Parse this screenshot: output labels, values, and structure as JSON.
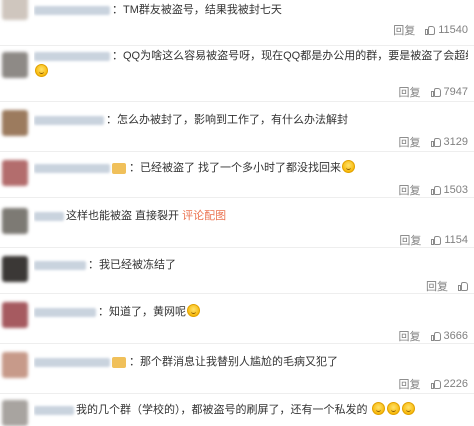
{
  "comments": [
    {
      "avatar_color": "#cfc6be",
      "text": "TM群友被盗号，结果我被封七天",
      "badge": false,
      "emoji_count": 0,
      "reply": "回复",
      "likes": "11540"
    },
    {
      "avatar_color": "#8e8a86",
      "text": "QQ为啥这么容易被盗号呀，现在QQ都是办公用的群，要是被盗了会超级无敌麻烦",
      "badge": false,
      "emoji_count": 1,
      "text_tail_emoji": 1,
      "reply": "回复",
      "likes": "7947"
    },
    {
      "avatar_color": "#9c7b5e",
      "text": "怎么办被封了，影响到工作了，有什么办法解封",
      "badge": false,
      "emoji_count": 0,
      "reply": "回复",
      "likes": "3129"
    },
    {
      "avatar_color": "#b36d6d",
      "text": "已经被盗了 找了一个多小时了都没找回来",
      "badge": true,
      "emoji_count": 1,
      "reply": "回复",
      "likes": "1503"
    },
    {
      "avatar_color": "#7d7a74",
      "text": "这样也能被盗 直接裂开",
      "link": "评论配图",
      "badge": false,
      "emoji_count": 0,
      "reply": "回复",
      "likes": "1154"
    },
    {
      "avatar_color": "#3b3836",
      "text": "我已经被冻结了",
      "badge": false,
      "emoji_count": 0,
      "reply": "回复",
      "likes": ""
    },
    {
      "avatar_color": "#a65a60",
      "text": "知道了，黄网呢",
      "badge": false,
      "emoji_count": 1,
      "reply": "回复",
      "likes": "3666"
    },
    {
      "avatar_color": "#c79a8a",
      "text": "那个群消息让我替别人尴尬的毛病又犯了",
      "badge": true,
      "emoji_count": 0,
      "reply": "回复",
      "likes": "2226"
    },
    {
      "avatar_color": "#a8a4a0",
      "text": "我的几个群（学校的），都被盗号的刷屏了，还有一个私发的",
      "badge": false,
      "emoji_count": 3,
      "reply": "",
      "likes": ""
    }
  ]
}
